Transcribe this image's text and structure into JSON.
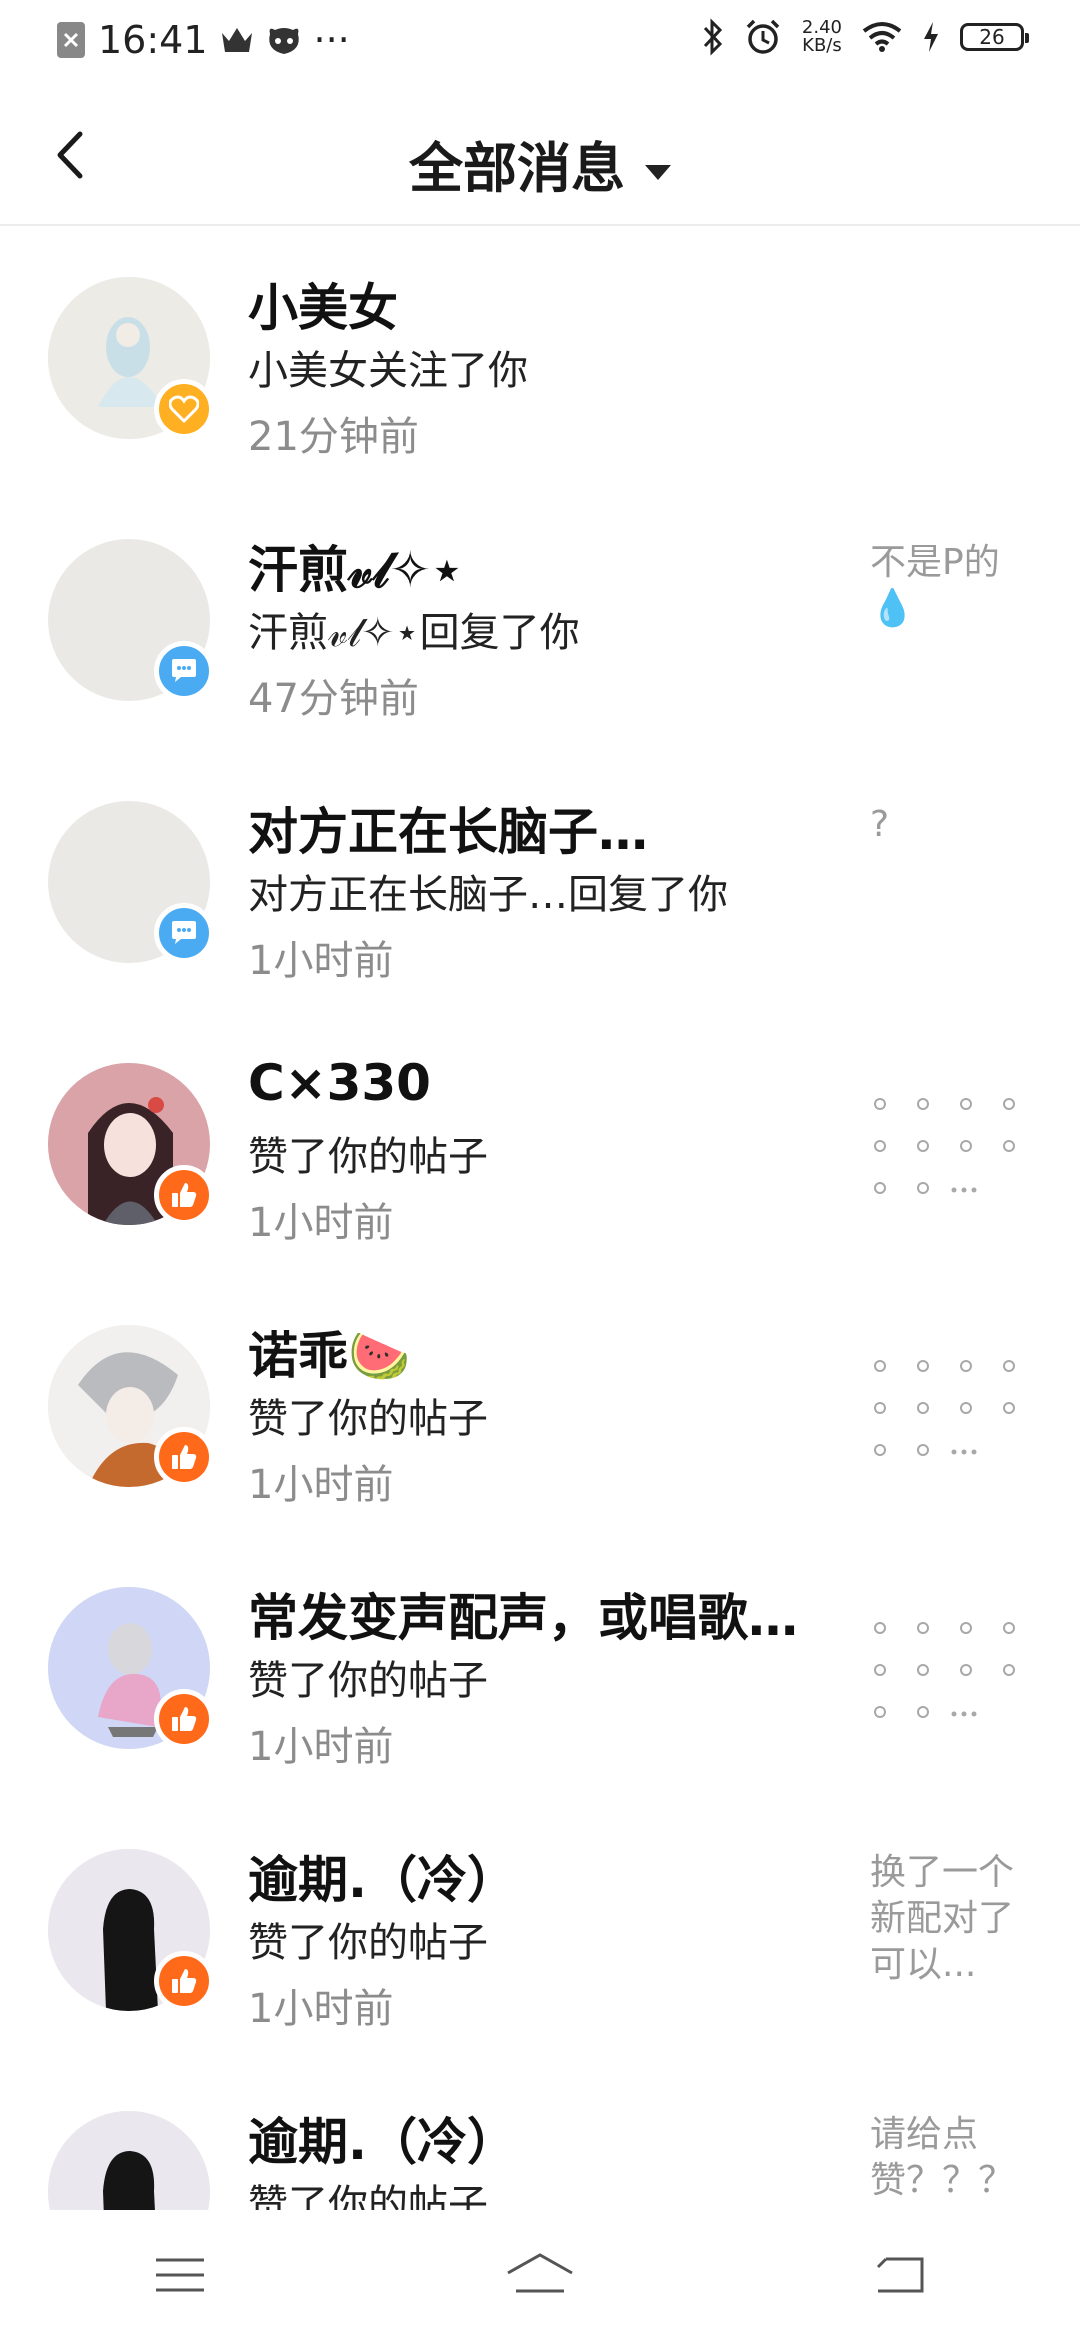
{
  "status_bar": {
    "time": "16:41",
    "net_speed_value": "2.40",
    "net_speed_unit": "KB/s",
    "battery": "26",
    "more": "···"
  },
  "header": {
    "title": "全部消息"
  },
  "messages": [
    {
      "name": "小美女",
      "action": "小美女关注了你",
      "time": "21分钟前",
      "badge": "heart-icon",
      "preview": ""
    },
    {
      "name": "汗煎𝓋𝓁✧⋆",
      "action": "汗煎𝓋𝓁✧⋆回复了你",
      "time": "47分钟前",
      "badge": "comment-icon",
      "preview": "不是P的💧"
    },
    {
      "name": "对方正在长脑子…",
      "action": "对方正在长脑子…回复了你",
      "time": "1小时前",
      "badge": "comment-icon",
      "preview": "?"
    },
    {
      "name": "C×330",
      "action": "赞了你的帖子",
      "time": "1小时前",
      "badge": "like-icon",
      "preview": ""
    },
    {
      "name": "诺乖🍉",
      "action": "赞了你的帖子",
      "time": "1小时前",
      "badge": "like-icon",
      "preview": ""
    },
    {
      "name": "常发变声配声，或唱歌…",
      "action": "赞了你的帖子",
      "time": "1小时前",
      "badge": "like-icon",
      "preview": ""
    },
    {
      "name": "逾期.（冷）",
      "action": "赞了你的帖子",
      "time": "1小时前",
      "badge": "like-icon",
      "preview": "换了一个新配对了可以..."
    },
    {
      "name": "逾期.（冷）",
      "action": "赞了你的帖子",
      "time": "",
      "badge": "like-icon",
      "preview": "请给点赞？？？"
    }
  ],
  "colors": {
    "heart_badge": "#ffb022",
    "comment_badge": "#4aabf2",
    "like_badge": "#ff6a1a",
    "divider": "#ececec"
  }
}
